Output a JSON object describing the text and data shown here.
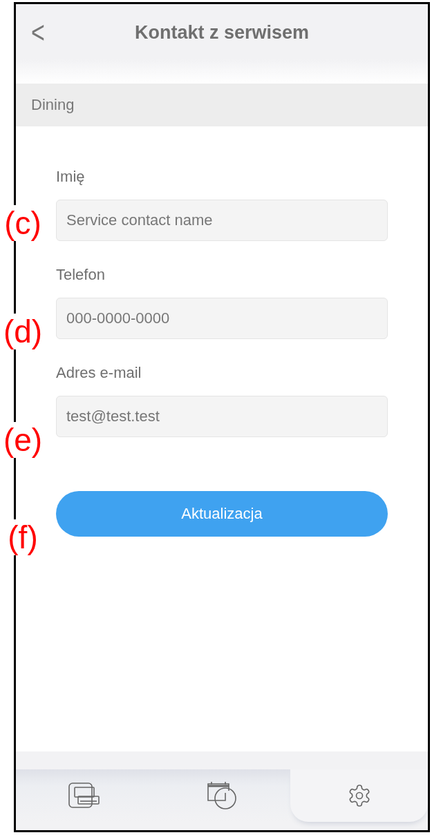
{
  "header": {
    "back": "<",
    "title": "Kontakt z serwisem"
  },
  "section": {
    "title": "Dining"
  },
  "fields": [
    {
      "label": "Imię",
      "placeholder": "Service contact name",
      "annotation": "(c)"
    },
    {
      "label": "Telefon",
      "placeholder": "000-0000-0000",
      "annotation": "(d)"
    },
    {
      "label": "Adres e-mail",
      "value": "test@test.test",
      "annotation": "(e)"
    }
  ],
  "button": {
    "label": "Aktualizacja",
    "annotation": "(f)"
  },
  "tabs": [
    {
      "kind": "devices",
      "selected": false
    },
    {
      "kind": "schedule",
      "selected": false
    },
    {
      "kind": "settings",
      "selected": true
    }
  ]
}
